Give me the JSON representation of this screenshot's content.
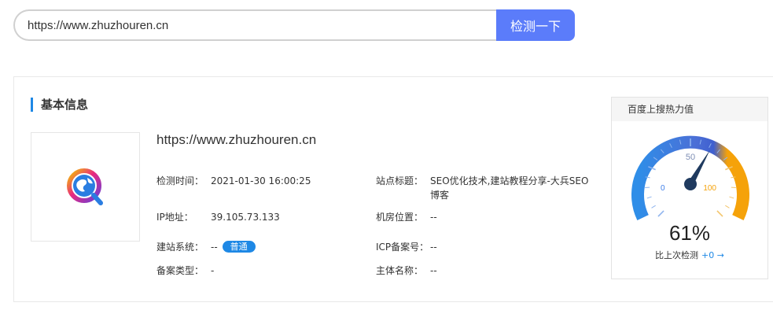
{
  "search": {
    "value": "https://www.zhuzhouren.cn",
    "button_label": "检测一下"
  },
  "basic": {
    "title": "基本信息",
    "url": "https://www.zhuzhouren.cn",
    "rows": {
      "check_time": {
        "label": "检测时间：",
        "value": "2021-01-30 16:00:25"
      },
      "site_title": {
        "label": "站点标题：",
        "value_line1": "SEO优化技术,建站教程分享-大兵SEO",
        "value_line2": "博客"
      },
      "ip": {
        "label": "IP地址：",
        "value": "39.105.73.133"
      },
      "location": {
        "label": "机房位置：",
        "value": "--"
      },
      "cms": {
        "label": "建站系统：",
        "value": "--",
        "badge": "普通"
      },
      "icp": {
        "label": "ICP备案号：",
        "value": "--"
      },
      "record_type": {
        "label": "备案类型：",
        "value": "-"
      },
      "owner": {
        "label": "主体名称：",
        "value": "--"
      }
    }
  },
  "heat": {
    "title": "百度上搜热力值",
    "percent": "61%",
    "percent_value": 61,
    "compare_label": "比上次检测",
    "compare_delta": "+0 →",
    "gauge_min": "0",
    "gauge_mid": "50",
    "gauge_max": "100"
  },
  "colors": {
    "accent": "#5b7cfa",
    "blue": "#1e88e5",
    "gauge_blue": "#3f7fe8",
    "gauge_orange": "#f5a20a",
    "needle": "#1f3a5f"
  },
  "icons": {
    "site_logo": "globe-q-logo-icon",
    "needle": "gauge-needle-icon"
  }
}
